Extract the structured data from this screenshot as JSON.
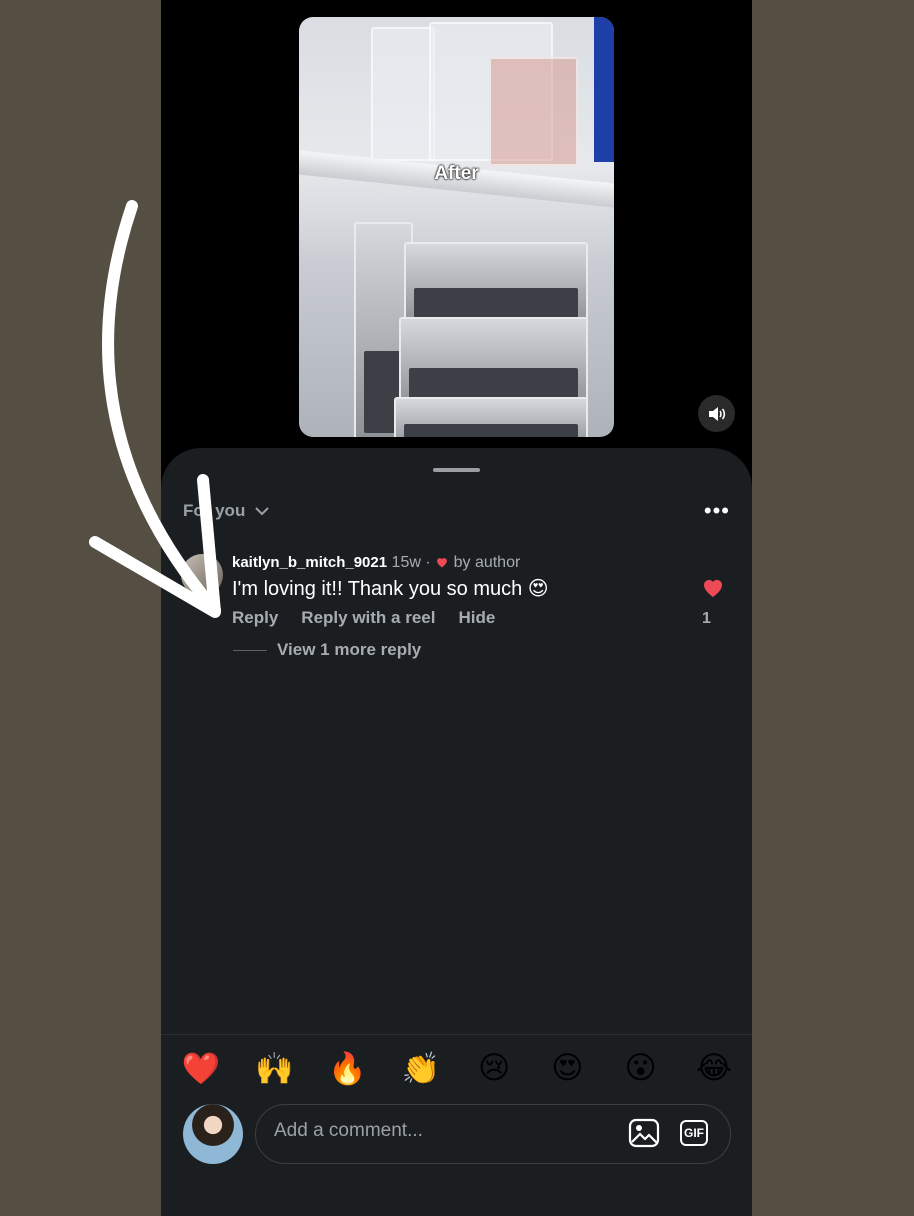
{
  "video": {
    "caption": "After"
  },
  "comments_sheet": {
    "sort_label": "For you",
    "comment": {
      "username": "kaitlyn_b_mitch_9021",
      "age": "15w",
      "separator": "·",
      "liked_by": "by author",
      "text": "I'm loving it!! Thank you so much 😍",
      "reply_label": "Reply",
      "reply_reel_label": "Reply with a reel",
      "hide_label": "Hide",
      "like_count": "1",
      "view_more_label": "View 1 more reply"
    },
    "reactions": [
      "❤️",
      "🙌",
      "🔥",
      "👏",
      "😢",
      "😍",
      "😮",
      "😂"
    ],
    "input": {
      "placeholder": "Add a comment...",
      "gif_label": "GIF"
    }
  },
  "colors": {
    "background": "#554f43",
    "sheet": "#1b1e21",
    "heart": "#ed4956",
    "muted_text": "#a7acb1"
  }
}
